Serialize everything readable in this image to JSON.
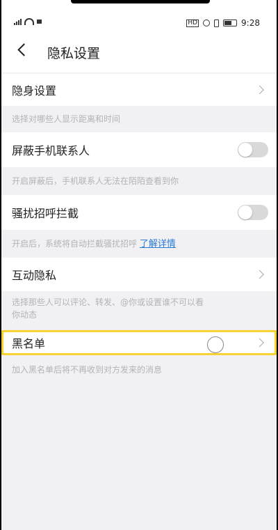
{
  "status_bar": {
    "hd_label": "HD",
    "time": "9:28"
  },
  "header": {
    "title": "隐私设置"
  },
  "sections": {
    "invisible": {
      "label": "隐身设置",
      "desc": "选择对哪些人显示距离和时间"
    },
    "block_contacts": {
      "label": "屏蔽手机联系人",
      "desc": "开启屏蔽后，手机联系人无法在陌陌查看到你",
      "toggle_on": false
    },
    "harass_block": {
      "label": "骚扰招呼拦截",
      "desc": "开启后，系统将自动拦截骚扰招呼",
      "link": "了解详情",
      "toggle_on": false
    },
    "interaction_privacy": {
      "label": "互动隐私",
      "desc_line1": "选择那些人可以评论、转发、@你或设置谁不可以看",
      "desc_line2": "你动态"
    },
    "blacklist": {
      "label": "黑名单",
      "desc": "加入黑名单后将不再收到对方发来的消息"
    }
  },
  "colors": {
    "highlight": "#f7d232",
    "link": "#2b7bd8"
  }
}
